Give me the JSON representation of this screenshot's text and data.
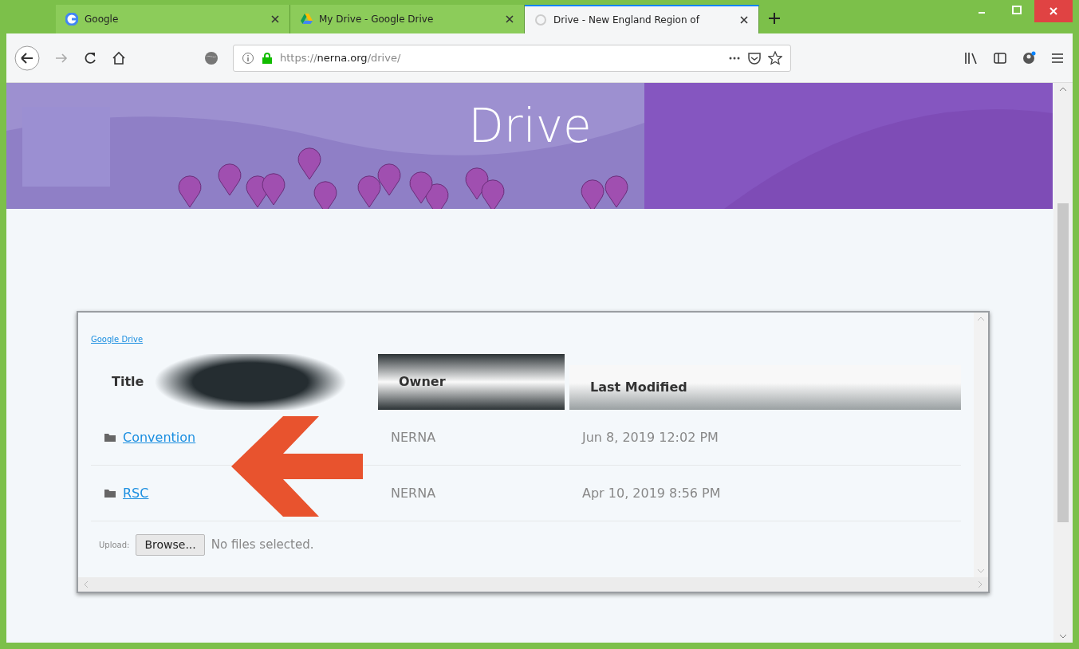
{
  "tabs": [
    {
      "title": "Google",
      "selected": false,
      "kind": "google"
    },
    {
      "title": "My Drive - Google Drive",
      "selected": false,
      "kind": "drive"
    },
    {
      "title": "Drive - New England Region of",
      "selected": true,
      "kind": "loading"
    }
  ],
  "address": {
    "scheme": "https://",
    "host": "nerna.org",
    "path": "/drive/"
  },
  "hero": {
    "title": "Drive"
  },
  "embed": {
    "link": "Google Drive",
    "columns": [
      "Title",
      "Owner",
      "Last Modified"
    ],
    "rows": [
      {
        "title": "Convention",
        "owner": "NERNA",
        "modified": "Jun 8, 2019 12:02 PM"
      },
      {
        "title": "RSC",
        "owner": "NERNA",
        "modified": "Apr 10, 2019 8:56 PM"
      }
    ],
    "upload": {
      "label": "Upload:",
      "button": "Browse...",
      "status": "No files selected."
    }
  }
}
